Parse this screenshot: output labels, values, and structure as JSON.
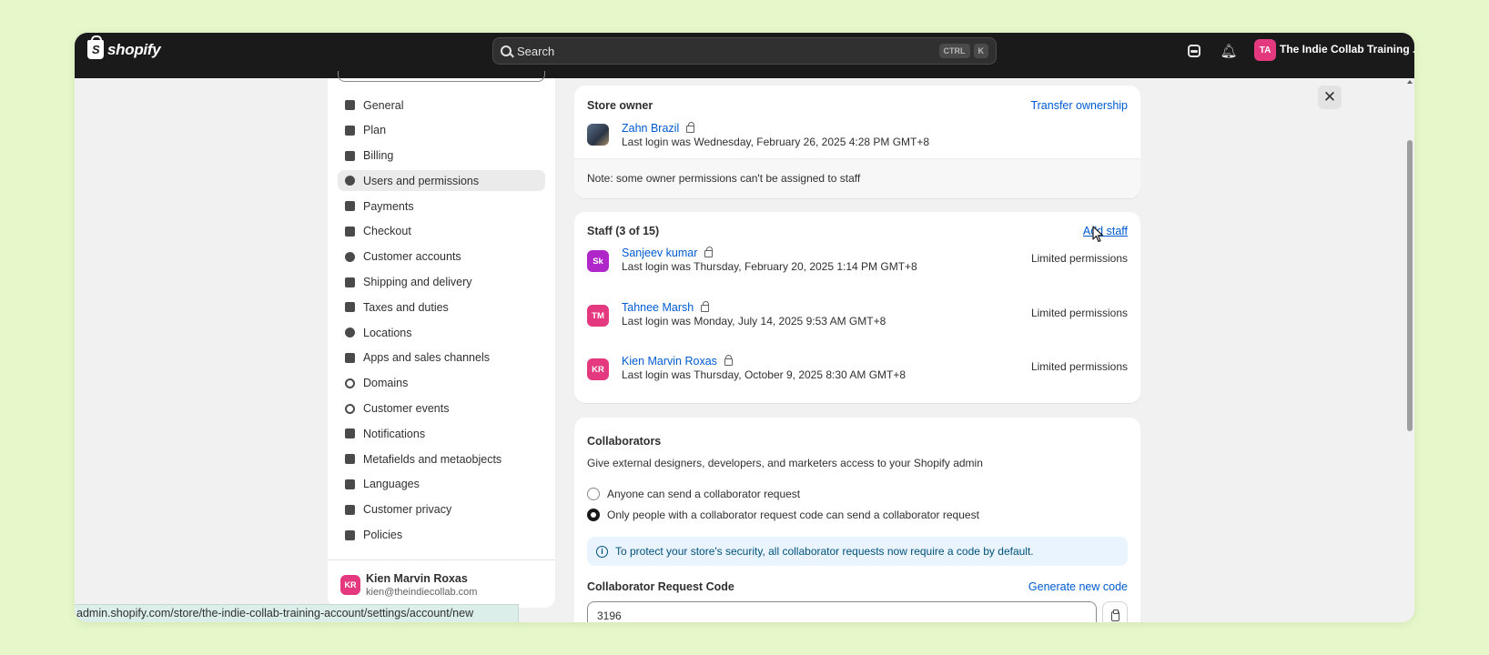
{
  "topbar": {
    "logo_text": "shopify",
    "search_placeholder": "Search",
    "kbd_ctrl": "CTRL",
    "kbd_k": "K",
    "store_initials": "TA",
    "store_name": "The Indie Collab Training ..."
  },
  "sidebar": {
    "items": [
      {
        "label": "General",
        "icon": "store-icon",
        "active": false
      },
      {
        "label": "Plan",
        "icon": "plan-icon",
        "active": false
      },
      {
        "label": "Billing",
        "icon": "billing-icon",
        "active": false
      },
      {
        "label": "Users and permissions",
        "icon": "users-icon",
        "active": true
      },
      {
        "label": "Payments",
        "icon": "payments-icon",
        "active": false
      },
      {
        "label": "Checkout",
        "icon": "cart-icon",
        "active": false
      },
      {
        "label": "Customer accounts",
        "icon": "person-icon",
        "active": false
      },
      {
        "label": "Shipping and delivery",
        "icon": "truck-icon",
        "active": false
      },
      {
        "label": "Taxes and duties",
        "icon": "money-bag-icon",
        "active": false
      },
      {
        "label": "Locations",
        "icon": "location-pin-icon",
        "active": false
      },
      {
        "label": "Apps and sales channels",
        "icon": "apps-icon",
        "active": false
      },
      {
        "label": "Domains",
        "icon": "globe-icon",
        "active": false
      },
      {
        "label": "Customer events",
        "icon": "cursor-click-icon",
        "active": false
      },
      {
        "label": "Notifications",
        "icon": "bell-icon",
        "active": false
      },
      {
        "label": "Metafields and metaobjects",
        "icon": "metafields-icon",
        "active": false
      },
      {
        "label": "Languages",
        "icon": "language-icon",
        "active": false
      },
      {
        "label": "Customer privacy",
        "icon": "lock-icon",
        "active": false
      },
      {
        "label": "Policies",
        "icon": "policy-icon",
        "active": false
      }
    ],
    "user": {
      "initials": "KR",
      "name": "Kien Marvin Roxas",
      "email": "kien@theindiecollab.com"
    }
  },
  "owner": {
    "title": "Store owner",
    "transfer_label": "Transfer ownership",
    "name": "Zahn Brazil",
    "last_login": "Last login was Wednesday, February 26, 2025 4:28 PM GMT+8",
    "note": "Note: some owner permissions can't be assigned to staff"
  },
  "staff": {
    "title": "Staff (3 of 15)",
    "add_label": "Add staff",
    "members": [
      {
        "initials": "Sk",
        "name": "Sanjeev kumar",
        "last_login": "Last login was Thursday, February 20, 2025 1:14 PM GMT+8",
        "permissions": "Limited permissions",
        "color": "#b027c9"
      },
      {
        "initials": "TM",
        "name": "Tahnee Marsh",
        "last_login": "Last login was Monday, July 14, 2025 9:53 AM GMT+8",
        "permissions": "Limited permissions",
        "color": "#e5397f"
      },
      {
        "initials": "KR",
        "name": "Kien Marvin Roxas",
        "last_login": "Last login was Thursday, October 9, 2025 8:30 AM GMT+8",
        "permissions": "Limited permissions",
        "color": "#e5397f"
      }
    ]
  },
  "collaborators": {
    "title": "Collaborators",
    "description": "Give external designers, developers, and marketers access to your Shopify admin",
    "option_anyone": "Anyone can send a collaborator request",
    "option_code": "Only people with a collaborator request code can send a collaborator request",
    "selected_option": "code",
    "banner": "To protect your store's security, all collaborator requests now require a code by default.",
    "code_label": "Collaborator Request Code",
    "generate_label": "Generate new code",
    "code_value": "3196"
  },
  "status_url": "admin.shopify.com/store/the-indie-collab-training-account/settings/account/new",
  "colors": {
    "topbar": "#1a1a1a",
    "link": "#005bd3",
    "avatar_pink": "#e5397f",
    "avatar_purple": "#b027c9",
    "banner_bg": "#eaf4ff"
  }
}
